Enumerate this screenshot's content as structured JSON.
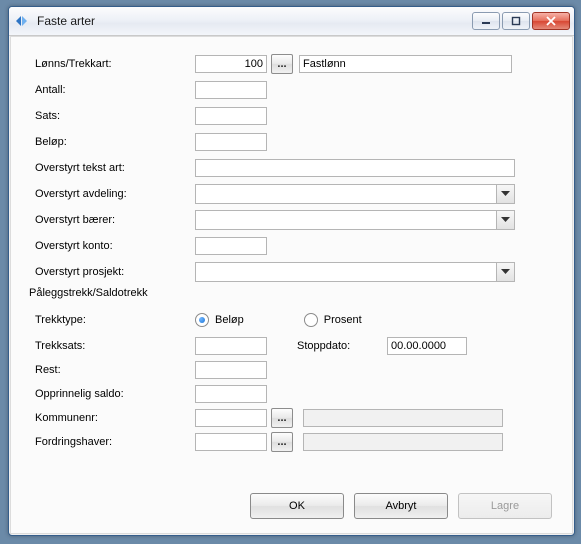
{
  "window": {
    "title": "Faste arter",
    "minimize": "−",
    "maximize": "□",
    "close": "×"
  },
  "form": {
    "lonns_trekkart_label": "Lønns/Trekkart:",
    "lonns_trekkart_value": "100",
    "lonns_trekkart_lookup": "...",
    "lonns_trekkart_name": "Fastlønn",
    "antall_label": "Antall:",
    "sats_label": "Sats:",
    "belop_label": "Beløp:",
    "over_tekst_label": "Overstyrt tekst art:",
    "over_avdeling_label": "Overstyrt avdeling:",
    "over_baerer_label": "Overstyrt bærer:",
    "over_konto_label": "Overstyrt konto:",
    "over_prosjekt_label": "Overstyrt prosjekt:"
  },
  "section": {
    "heading": "Påleggstrekk/Saldotrekk",
    "trekktype_label": "Trekktype:",
    "radio_belop": "Beløp",
    "radio_prosent": "Prosent",
    "trekksats_label": "Trekksats:",
    "stoppdato_label": "Stoppdato:",
    "stoppdato_value": "00.00.0000",
    "rest_label": "Rest:",
    "opprinnelig_label": "Opprinnelig saldo:",
    "kommunenr_label": "Kommunenr:",
    "kommunenr_lookup": "...",
    "fordringshaver_label": "Fordringshaver:",
    "fordringshaver_lookup": "..."
  },
  "buttons": {
    "ok": "OK",
    "avbryt": "Avbryt",
    "lagre": "Lagre"
  }
}
